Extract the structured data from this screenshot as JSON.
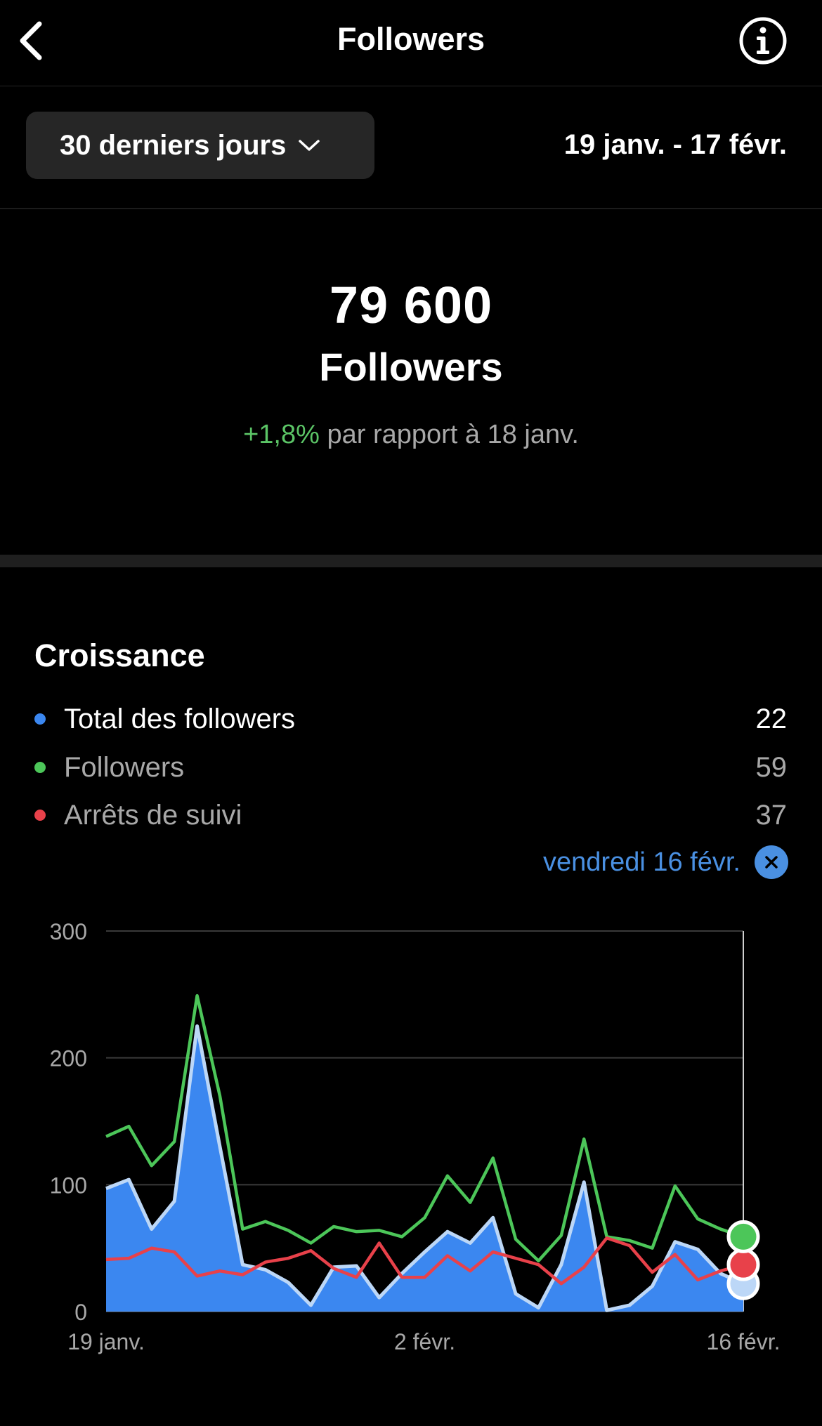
{
  "header": {
    "title": "Followers",
    "back_icon": "chevron-left-icon",
    "info_icon": "info-icon"
  },
  "period": {
    "label": "30 derniers jours",
    "range": "19 janv. - 17 févr."
  },
  "summary": {
    "count": "79 600",
    "label": "Followers",
    "change": "+1,8%",
    "change_suffix": " par rapport à 18 janv."
  },
  "growth": {
    "title": "Croissance",
    "legend": [
      {
        "label": "Total des followers",
        "value": "22",
        "color": "#3b87f0"
      },
      {
        "label": "Followers",
        "value": "59",
        "color": "#4cc659"
      },
      {
        "label": "Arrêts de suivi",
        "value": "37",
        "color": "#e8414a"
      }
    ],
    "selected_date": "vendredi 16 févr."
  },
  "colors": {
    "accent": "#4a90e2",
    "positive": "#5bc466",
    "total": "#3b87f0",
    "followers": "#4cc659",
    "unfollows": "#e8414a"
  },
  "chart_data": {
    "type": "area",
    "x": [
      "19 janv.",
      "20 janv.",
      "21 janv.",
      "22 janv.",
      "23 janv.",
      "24 janv.",
      "25 janv.",
      "26 janv.",
      "27 janv.",
      "28 janv.",
      "29 janv.",
      "30 janv.",
      "31 janv.",
      "1 févr.",
      "2 févr.",
      "3 févr.",
      "4 févr.",
      "5 févr.",
      "6 févr.",
      "7 févr.",
      "8 févr.",
      "9 févr.",
      "10 févr.",
      "11 févr.",
      "12 févr.",
      "13 févr.",
      "14 févr.",
      "15 févr.",
      "16 févr."
    ],
    "xticks": [
      "19 janv.",
      "2 févr.",
      "16 févr."
    ],
    "yticks": [
      0,
      100,
      200,
      300
    ],
    "ylim": [
      0,
      300
    ],
    "series": [
      {
        "name": "Total des followers",
        "type": "area",
        "values": [
          97,
          104,
          65,
          87,
          225,
          130,
          37,
          33,
          23,
          5,
          35,
          36,
          11,
          30,
          47,
          63,
          54,
          74,
          14,
          3,
          37,
          102,
          1,
          5,
          20,
          55,
          49,
          30,
          22
        ]
      },
      {
        "name": "Followers",
        "type": "line",
        "values": [
          138,
          146,
          115,
          134,
          249,
          170,
          65,
          71,
          64,
          54,
          67,
          63,
          64,
          59,
          74,
          107,
          86,
          121,
          57,
          40,
          60,
          136,
          59,
          56,
          50,
          99,
          73,
          65,
          59
        ]
      },
      {
        "name": "Arrêts de suivi",
        "type": "line",
        "values": [
          41,
          42,
          50,
          47,
          28,
          32,
          29,
          39,
          42,
          48,
          34,
          27,
          54,
          27,
          27,
          44,
          32,
          47,
          42,
          37,
          22,
          35,
          58,
          52,
          31,
          45,
          25,
          32,
          37
        ]
      }
    ]
  }
}
